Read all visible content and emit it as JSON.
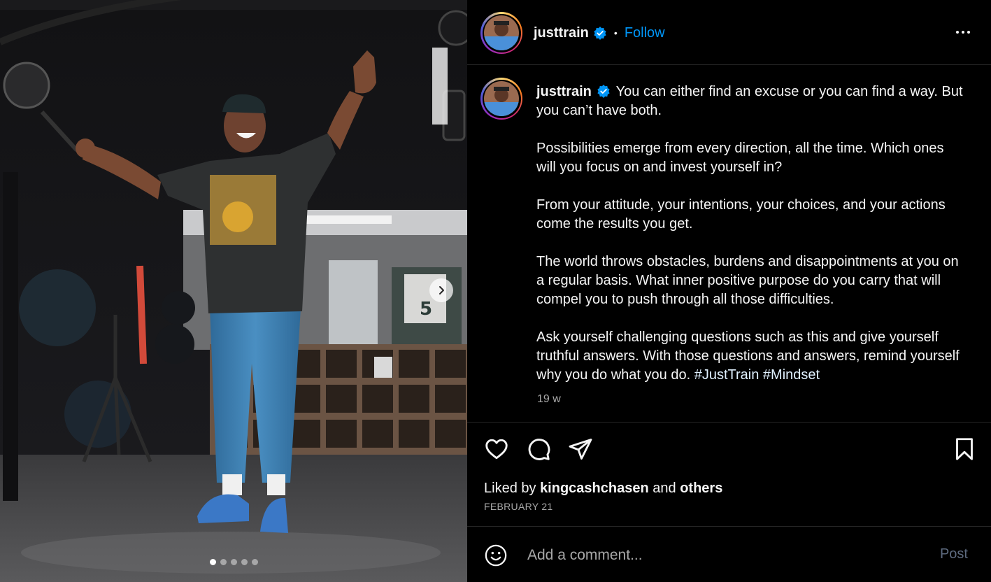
{
  "account": {
    "username": "justtrain",
    "verified_icon": "verified-badge-icon",
    "follow_label": "Follow",
    "bullet": "•"
  },
  "caption": {
    "username": "justtrain",
    "paragraphs": [
      "You can either find an excuse or you can find a way. But you can’t have both.",
      "Possibilities emerge from every direction, all the time. Which ones will you focus on and invest yourself in?",
      "From your attitude, your intentions, your choices, and your actions come the results you get.",
      "The world throws obstacles, burdens and disappointments at you on a regular basis. What inner positive purpose do you carry that will compel you to push through all those difficulties."
    ],
    "last_paragraph": "Ask yourself challenging questions such as this and give yourself truthful answers. With those questions and answers, remind yourself why you do what you do.",
    "hashtags": [
      "#JustTrain",
      "#Mindset"
    ],
    "time_ago": "19 w"
  },
  "likes": {
    "prefix": "Liked by",
    "user": "kingcashchasen",
    "and": "and",
    "others": "others"
  },
  "date": "FEBRUARY 21",
  "comment": {
    "placeholder": "Add a comment...",
    "post_label": "Post"
  },
  "media": {
    "slide_count": 5,
    "active_slide": 1,
    "jersey_number": "5"
  },
  "colors": {
    "accent": "#0095f6",
    "background": "#000000",
    "muted_text": "#a8a8a8",
    "post_disabled": "#5e6b80"
  },
  "icons": [
    "heart-icon",
    "comment-icon",
    "share-icon",
    "bookmark-icon",
    "emoji-icon",
    "more-options-icon",
    "chevron-right-icon"
  ]
}
